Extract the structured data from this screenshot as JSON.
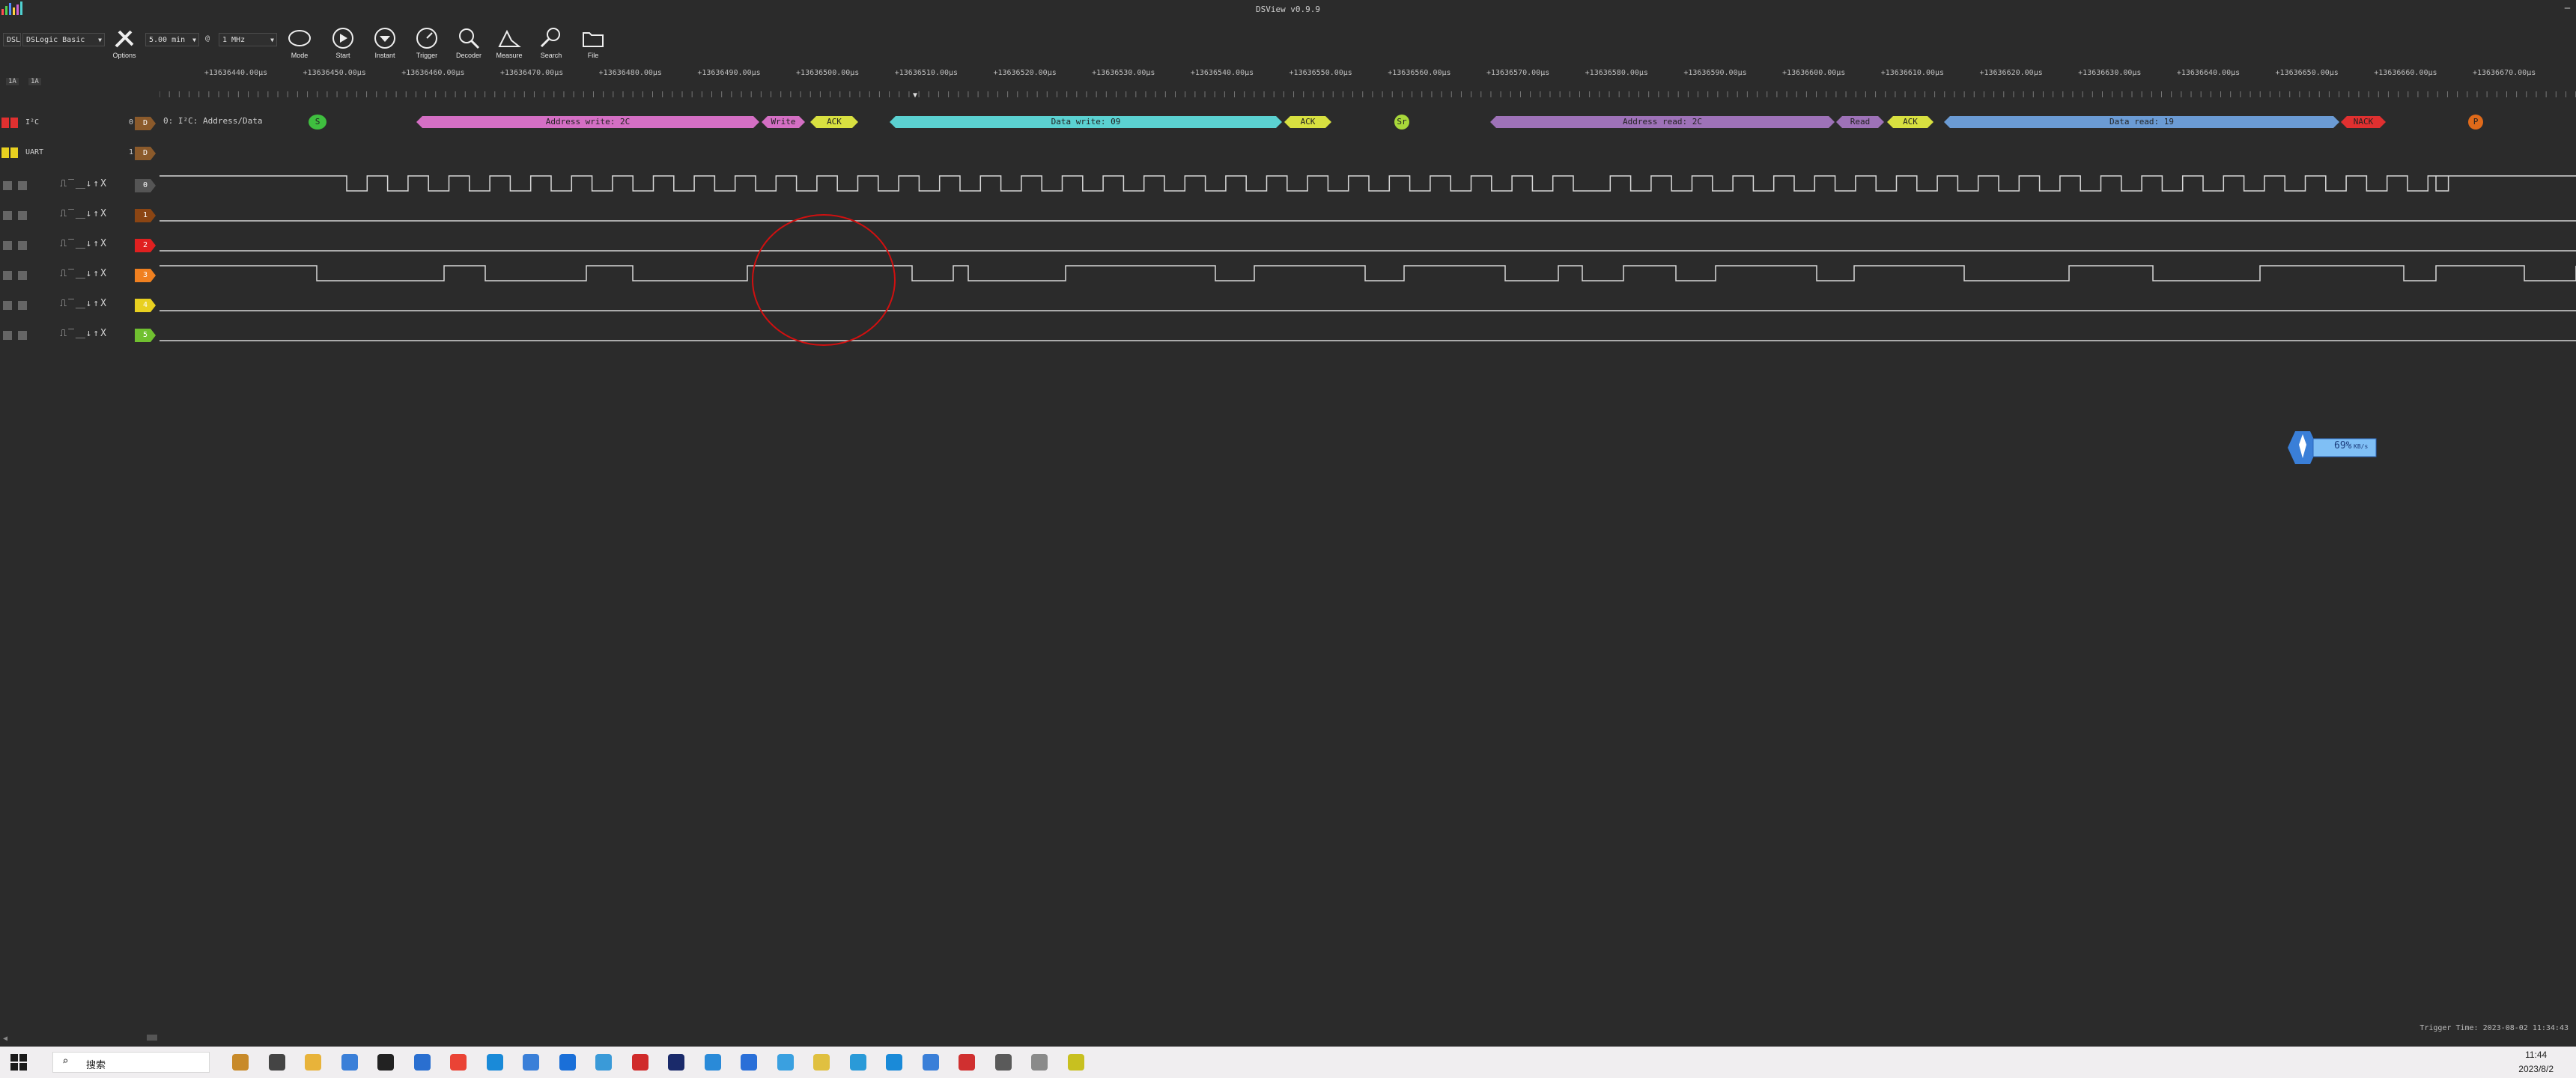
{
  "app": {
    "title": "DSView v0.9.9"
  },
  "toolbar": {
    "device": "DSLogic Basic",
    "device_prefix": "DSL",
    "time": "5.00 min",
    "at": "@",
    "rate": "1 MHz",
    "buttons": [
      "Options",
      "Mode",
      "Start",
      "Instant",
      "Trigger",
      "Decoder",
      "Measure",
      "Search",
      "File"
    ]
  },
  "ruler": {
    "ticks": [
      "+13636440.00μs",
      "+13636450.00μs",
      "+13636460.00μs",
      "+13636470.00μs",
      "+13636480.00μs",
      "+13636490.00μs",
      "+13636500.00μs",
      "+13636510.00μs",
      "+13636520.00μs",
      "+13636530.00μs",
      "+13636540.00μs",
      "+13636550.00μs",
      "+13636560.00μs",
      "+13636570.00μs",
      "+13636580.00μs",
      "+13636590.00μs",
      "+13636600.00μs",
      "+13636610.00μs",
      "+13636620.00μs",
      "+13636630.00μs",
      "+13636640.00μs",
      "+13636650.00μs",
      "+13636660.00μs",
      "+13636670.00μs"
    ]
  },
  "sidebar_top": {
    "a": "1A",
    "b": "1A"
  },
  "decoder_rows": [
    {
      "label": "I²C",
      "index": "0",
      "badge": "D",
      "badge_color": "#8b5a2b",
      "annotation": "0: I²C: Address/Data"
    },
    {
      "label": "UART",
      "index": "1",
      "badge": "D",
      "badge_color": "#8b5a2b"
    }
  ],
  "channels": [
    {
      "badge": "0",
      "color": "#555555"
    },
    {
      "badge": "1",
      "color": "#8b4513"
    },
    {
      "badge": "2",
      "color": "#e02020"
    },
    {
      "badge": "3",
      "color": "#f08020"
    },
    {
      "badge": "4",
      "color": "#e8d020"
    },
    {
      "badge": "5",
      "color": "#70c030"
    }
  ],
  "trigger_glyphs": "⎍‾⎽↓↑X",
  "decode": [
    {
      "text": "S",
      "kind": "circle",
      "color": "#3fbf3f"
    },
    {
      "text": "Address write: 2C",
      "color": "#d46fc4"
    },
    {
      "text": "Write",
      "color": "#d46fc4"
    },
    {
      "text": "ACK",
      "color": "#d8e040"
    },
    {
      "text": "Data write: 09",
      "color": "#5bd1d1"
    },
    {
      "text": "ACK",
      "color": "#d8e040"
    },
    {
      "text": "Sr",
      "kind": "circle",
      "color": "#a8d83a"
    },
    {
      "text": "Address read: 2C",
      "color": "#9e72b8"
    },
    {
      "text": "Read",
      "color": "#9e72b8"
    },
    {
      "text": "ACK",
      "color": "#d8e040"
    },
    {
      "text": "Data read: 19",
      "color": "#6b9bd4"
    },
    {
      "text": "NACK",
      "color": "#e03030"
    },
    {
      "text": "P",
      "kind": "circle",
      "color": "#e06a1a"
    }
  ],
  "speed": {
    "percent": "69%",
    "unit": "KB/s"
  },
  "trigger_time": "Trigger Time: 2023-08-02 11:34:43",
  "taskbar": {
    "search": "搜索",
    "time": "11:44",
    "date": "2023/8/2"
  }
}
